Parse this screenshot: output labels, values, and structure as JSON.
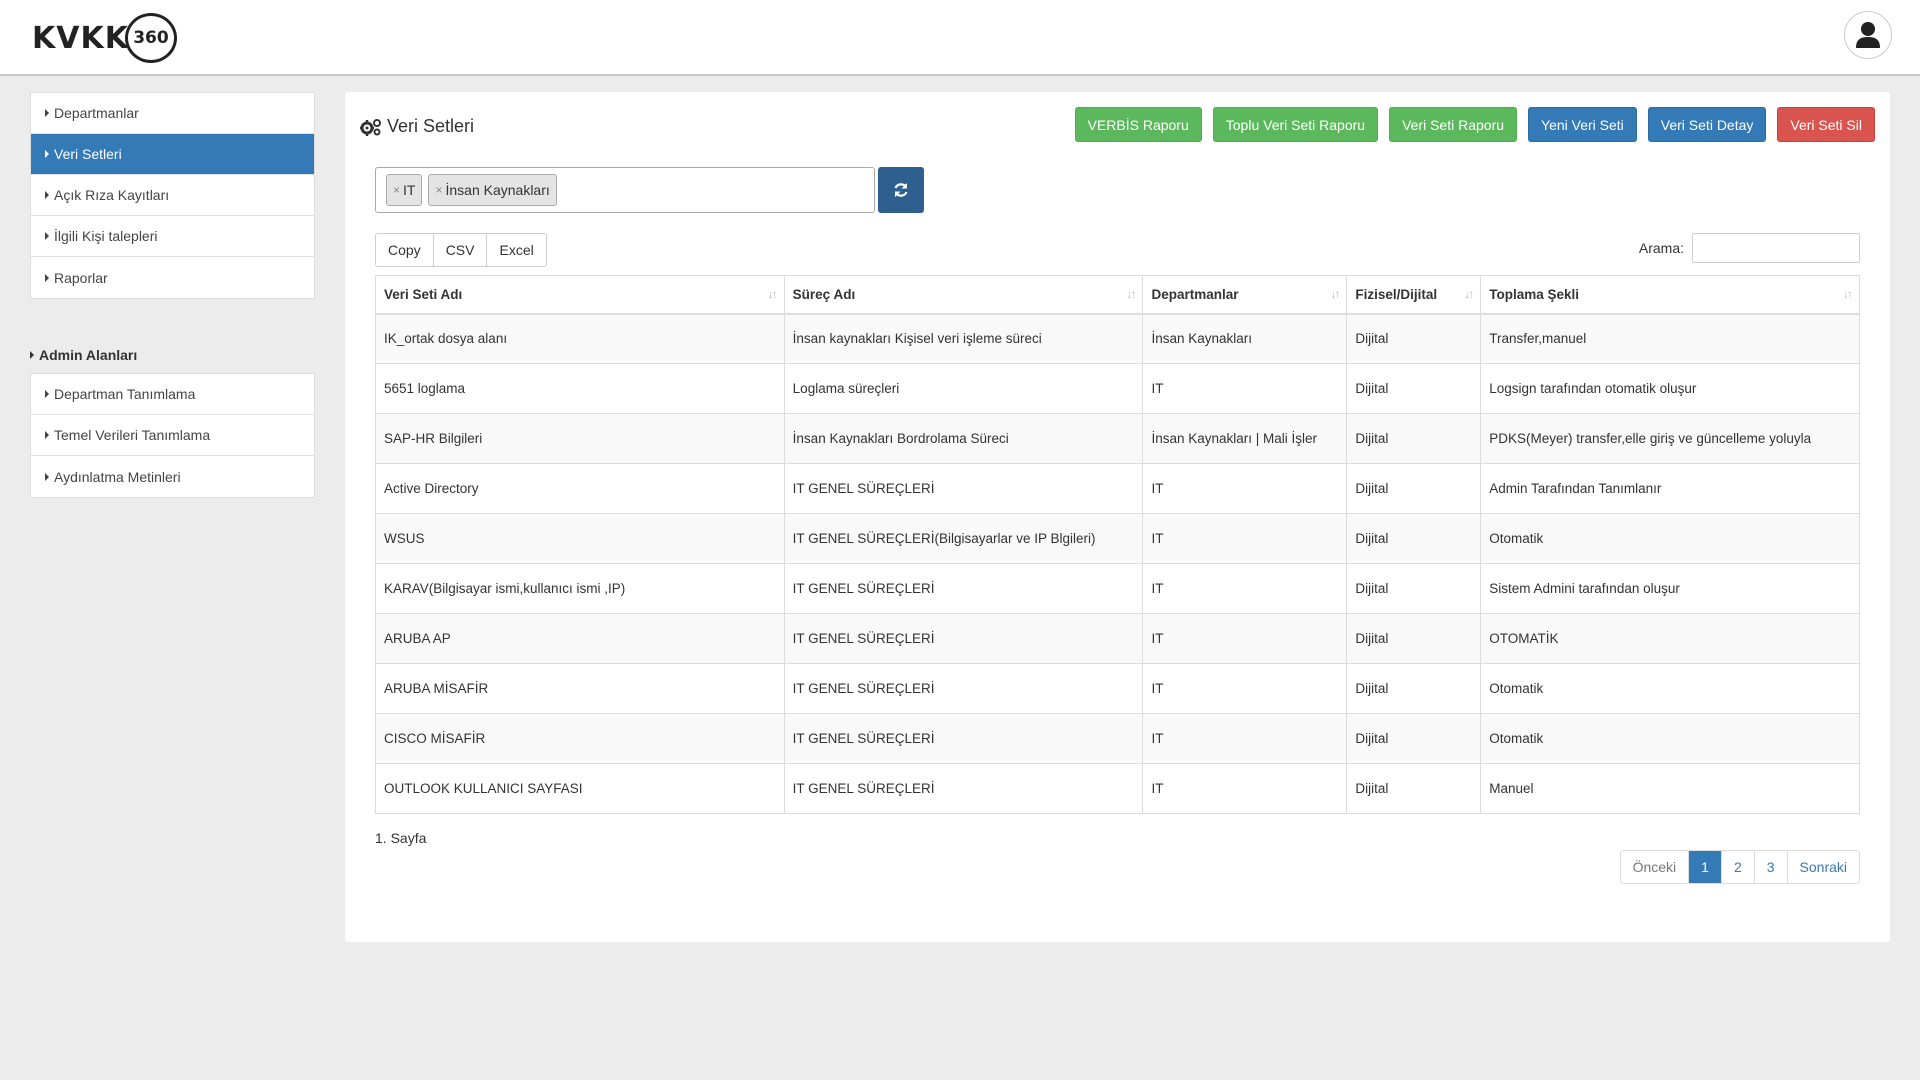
{
  "brand": {
    "text": "KVKK",
    "ring": "360"
  },
  "sidebar": {
    "items": [
      {
        "label": "Departmanlar",
        "active": false
      },
      {
        "label": "Veri Setleri",
        "active": true
      },
      {
        "label": "Açık Rıza Kayıtları",
        "active": false
      },
      {
        "label": "İlgili Kişi talepleri",
        "active": false
      },
      {
        "label": "Raporlar",
        "active": false
      }
    ],
    "admin_heading": "Admin Alanları",
    "admin_items": [
      {
        "label": "Departman Tanımlama"
      },
      {
        "label": "Temel Verileri Tanımlama"
      },
      {
        "label": "Aydınlatma Metinleri"
      }
    ]
  },
  "main": {
    "title": "Veri Setleri",
    "buttons": [
      {
        "label": "VERBİS Raporu",
        "color": "#5cb85c"
      },
      {
        "label": "Toplu Veri Seti Raporu",
        "color": "#5cb85c"
      },
      {
        "label": "Veri Seti Raporu",
        "color": "#5cb85c"
      },
      {
        "label": "Yeni Veri Seti",
        "color": "#337ab7"
      },
      {
        "label": "Veri Seti Detay",
        "color": "#337ab7"
      },
      {
        "label": "Veri Seti Sil",
        "color": "#d9534f"
      }
    ],
    "filter_tags": [
      "IT",
      "İnsan Kaynakları"
    ],
    "export_buttons": [
      "Copy",
      "CSV",
      "Excel"
    ],
    "search_label": "Arama:",
    "search_value": "",
    "table": {
      "columns": [
        "Veri Seti Adı",
        "Süreç Adı",
        "Departmanlar",
        "Fizisel/Dijital",
        "Toplama Şekli"
      ],
      "rows": [
        [
          "IK_ortak dosya alanı",
          "İnsan kaynakları Kişisel veri işleme süreci",
          "İnsan Kaynakları",
          "Dijital",
          "Transfer,manuel"
        ],
        [
          "5651 loglama",
          "Loglama süreçleri",
          "IT",
          "Dijital",
          "Logsign tarafından otomatik oluşur"
        ],
        [
          "SAP-HR Bilgileri",
          "İnsan Kaynakları Bordrolama Süreci",
          "İnsan Kaynakları | Mali İşler",
          "Dijital",
          "PDKS(Meyer) transfer,elle giriş ve güncelleme yoluyla"
        ],
        [
          "Active Directory",
          "IT GENEL SÜREÇLERİ",
          "IT",
          "Dijital",
          "Admin Tarafından Tanımlanır"
        ],
        [
          "WSUS",
          "IT GENEL SÜREÇLERİ(Bilgisayarlar ve IP Blgileri)",
          "IT",
          "Dijital",
          "Otomatik"
        ],
        [
          "KARAV(Bilgisayar ismi,kullanıcı ismi ,IP)",
          "IT GENEL SÜREÇLERİ",
          "IT",
          "Dijital",
          "Sistem Admini tarafından oluşur"
        ],
        [
          "ARUBA AP",
          "IT GENEL SÜREÇLERİ",
          "IT",
          "Dijital",
          "OTOMATİK"
        ],
        [
          "ARUBA MİSAFİR",
          "IT GENEL SÜREÇLERİ",
          "IT",
          "Dijital",
          "Otomatik"
        ],
        [
          "CISCO MİSAFİR",
          "IT GENEL SÜREÇLERİ",
          "IT",
          "Dijital",
          "Otomatik"
        ],
        [
          "OUTLOOK KULLANICI SAYFASI",
          "IT GENEL SÜREÇLERİ",
          "IT",
          "Dijital",
          "Manuel"
        ]
      ]
    },
    "page_info": "1. Sayfa",
    "pagination": {
      "prev": "Önceki",
      "pages": [
        "1",
        "2",
        "3"
      ],
      "current": "1",
      "next": "Sonraki"
    }
  }
}
